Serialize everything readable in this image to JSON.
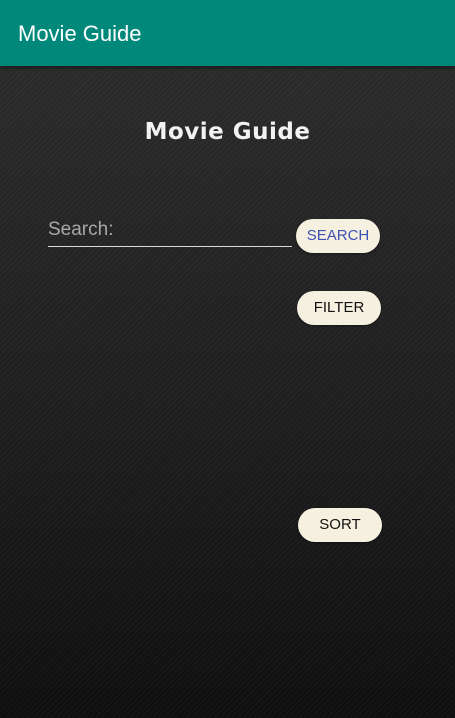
{
  "app_bar": {
    "title": "Movie Guide"
  },
  "main": {
    "heading": "Movie Guide",
    "search": {
      "placeholder": "Search:",
      "value": ""
    },
    "buttons": {
      "search_label": "SEARCH",
      "filter_label": "FILTER",
      "sort_label": "SORT"
    }
  },
  "colors": {
    "app_bar": "#00897b",
    "button_background": "#f6f0e0",
    "search_button_text": "#3f51b5"
  }
}
